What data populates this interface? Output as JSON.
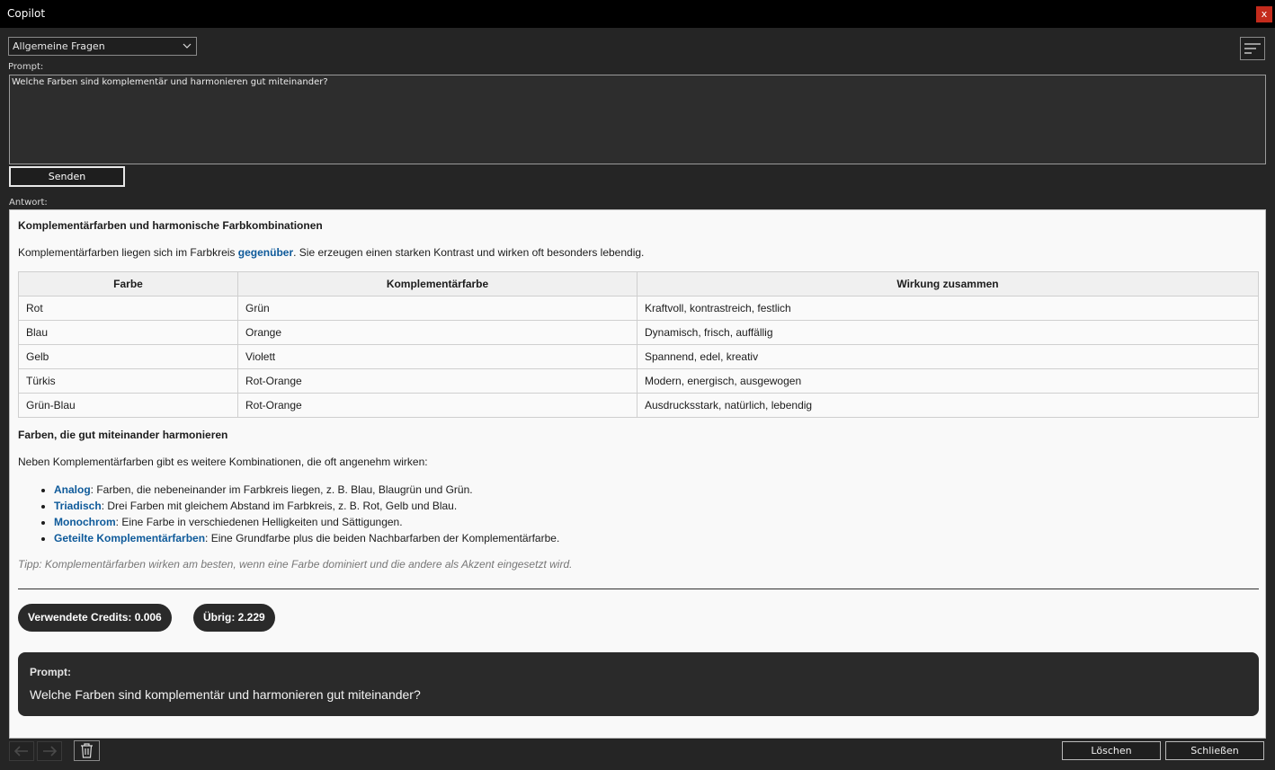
{
  "window": {
    "title": "Copilot",
    "close_label": "x"
  },
  "mode_select": {
    "value": "Allgemeine Fragen"
  },
  "prompt": {
    "label": "Prompt:",
    "value": "Welche Farben sind komplementär und harmonieren gut miteinander?"
  },
  "send_label": "Senden",
  "answer_label": "Antwort:",
  "answer": {
    "heading1": "Komplementärfarben und harmonische Farbkombinationen",
    "intro_before": "Komplementärfarben liegen sich im Farbkreis ",
    "intro_link": "gegenüber",
    "intro_after": ". Sie erzeugen einen starken Kontrast und wirken oft besonders lebendig.",
    "table": {
      "headers": [
        "Farbe",
        "Komplementärfarbe",
        "Wirkung zusammen"
      ],
      "rows": [
        [
          "Rot",
          "Grün",
          "Kraftvoll, kontrastreich, festlich"
        ],
        [
          "Blau",
          "Orange",
          "Dynamisch, frisch, auffällig"
        ],
        [
          "Gelb",
          "Violett",
          "Spannend, edel, kreativ"
        ],
        [
          "Türkis",
          "Rot-Orange",
          "Modern, energisch, ausgewogen"
        ],
        [
          "Grün-Blau",
          "Rot-Orange",
          "Ausdrucksstark, natürlich, lebendig"
        ]
      ]
    },
    "heading2": "Farben, die gut miteinander harmonieren",
    "intro2": "Neben Komplementärfarben gibt es weitere Kombinationen, die oft angenehm wirken:",
    "list": [
      {
        "term": "Analog",
        "text": ": Farben, die nebeneinander im Farbkreis liegen, z. B. Blau, Blaugrün und Grün."
      },
      {
        "term": "Triadisch",
        "text": ": Drei Farben mit gleichem Abstand im Farbkreis, z. B. Rot, Gelb und Blau."
      },
      {
        "term": "Monochrom",
        "text": ": Eine Farbe in verschiedenen Helligkeiten und Sättigungen."
      },
      {
        "term": "Geteilte Komplementärfarben",
        "text": ": Eine Grundfarbe plus die beiden Nachbarfarben der Komplementärfarbe."
      }
    ],
    "tip": "Tipp: Komplementärfarben wirken am besten, wenn eine Farbe dominiert und die andere als Akzent eingesetzt wird.",
    "credits_used": "Verwendete Credits: 0.006",
    "credits_left": "Übrig: 2.229",
    "prompt_card_label": "Prompt:",
    "prompt_card_text": "Welche Farben sind komplementär und harmonieren gut miteinander?"
  },
  "footer": {
    "delete_label": "Löschen",
    "close_label": "Schließen"
  },
  "colors": {
    "link": "#0e5a9a",
    "close": "#c42b1c"
  }
}
